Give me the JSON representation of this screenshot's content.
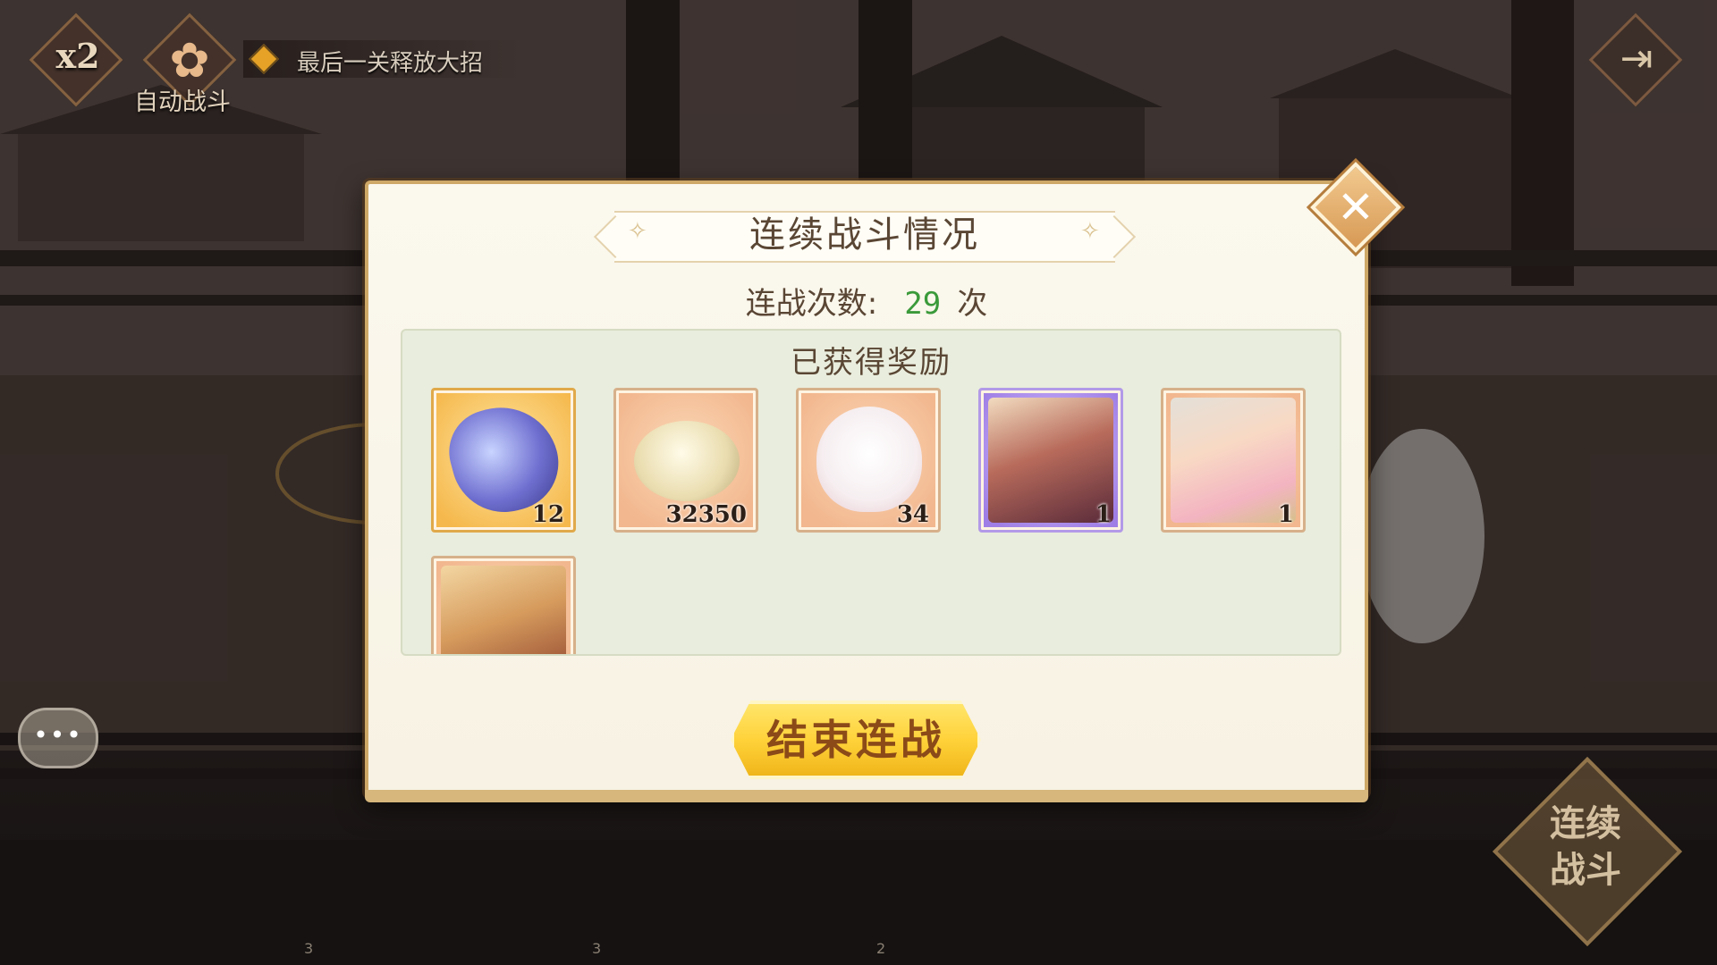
{
  "hud": {
    "speed_label": "x2",
    "auto_battle_label": "自动战斗",
    "auto_battle_icon": "flower-icon",
    "hint_text": "最后一关释放大招",
    "exit_icon": "exit-door-icon",
    "chat_icon": "chat-bubble-icon",
    "chat_text": "•••",
    "continuous_battle_label_line1": "连续",
    "continuous_battle_label_line2": "战斗",
    "bottom_numbers": [
      "3",
      "3",
      "2"
    ]
  },
  "modal": {
    "title": "连续战斗情况",
    "battle_count_label": "连战次数:",
    "battle_count_value": "29",
    "battle_count_unit": "次",
    "rewards_title": "已获得奖励",
    "rewards": [
      {
        "name": "crystal",
        "icon": "crystal-icon",
        "quantity": "12"
      },
      {
        "name": "shell-coin",
        "icon": "shell-coin-icon",
        "quantity": "32350"
      },
      {
        "name": "bunny-dumpling",
        "icon": "bunny-dumpling-icon",
        "quantity": "34"
      },
      {
        "name": "character-card-1",
        "icon": "character-portrait-icon",
        "quantity": "1"
      },
      {
        "name": "character-card-2",
        "icon": "character-portrait-icon",
        "quantity": "1"
      },
      {
        "name": "character-card-3",
        "icon": "character-portrait-icon",
        "quantity": ""
      }
    ],
    "end_button_label": "结束连战",
    "close_icon": "close-icon",
    "close_glyph": "✕"
  },
  "colors": {
    "count_value": "#3a9a3a",
    "button_yellow": "#ffd23a",
    "panel_bg": "#e9eddd",
    "frame_gold": "#cda867"
  }
}
